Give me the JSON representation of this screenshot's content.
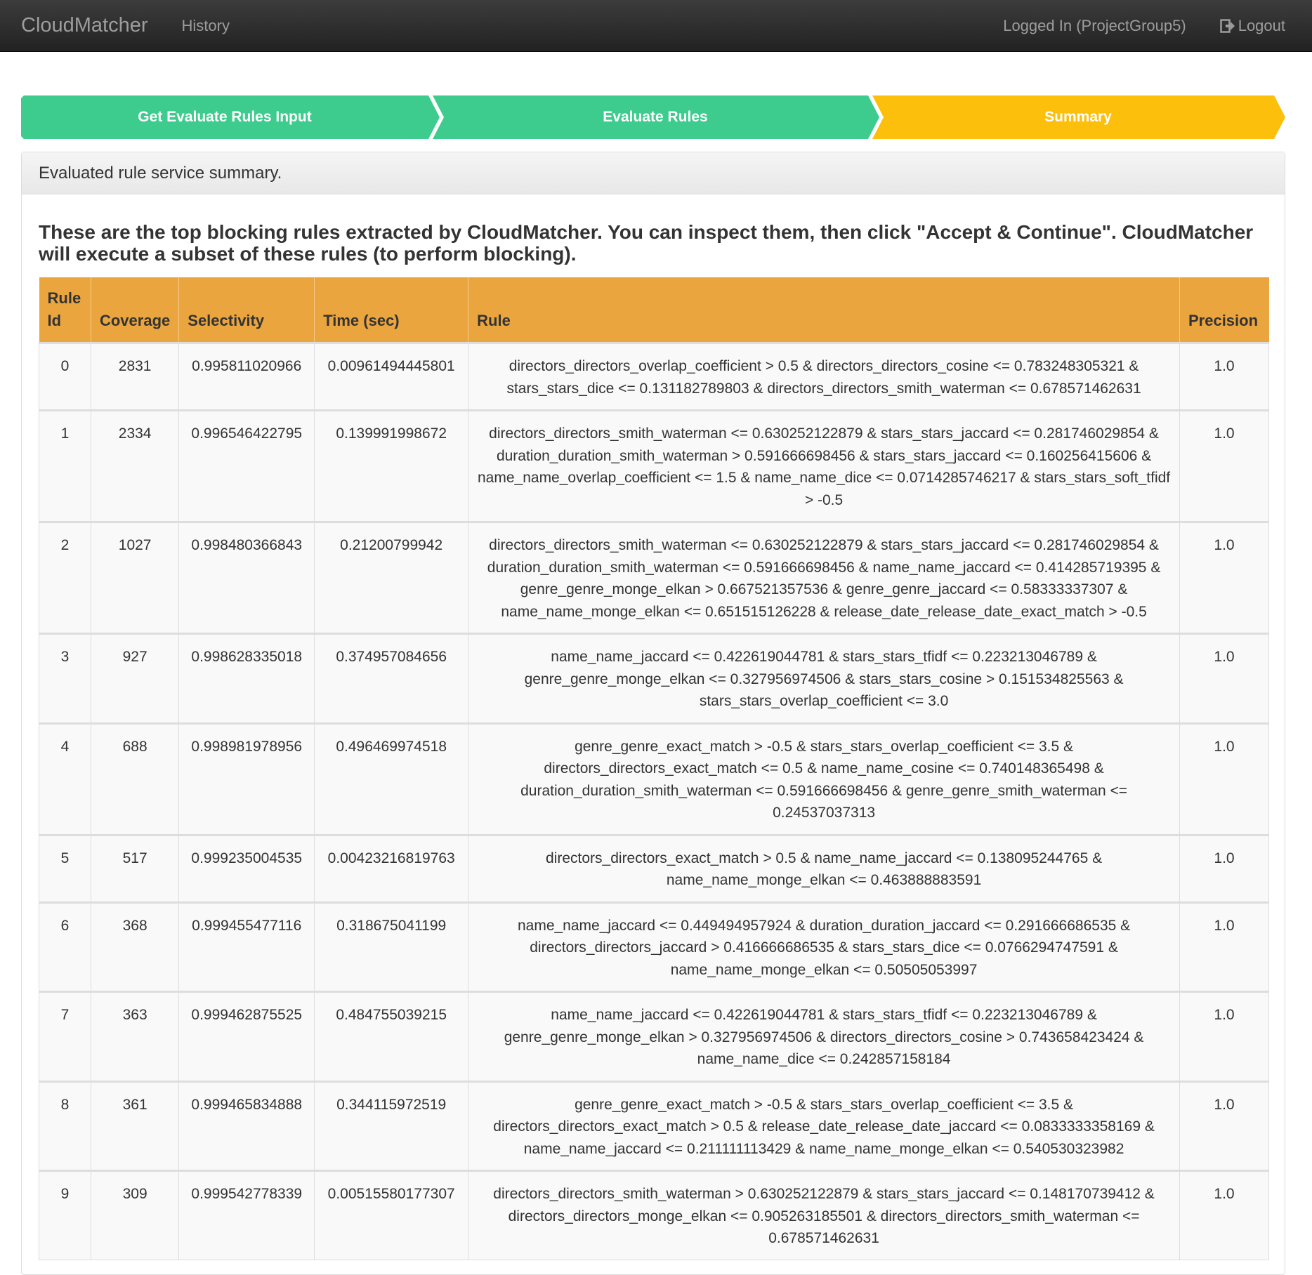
{
  "navbar": {
    "brand": "CloudMatcher",
    "history": "History",
    "user": "Logged In (ProjectGroup5)",
    "logout": "Logout",
    "logout_icon": "logout-icon"
  },
  "wizard": {
    "steps": [
      {
        "label": "Get Evaluate Rules Input",
        "color": "#3dcc8e"
      },
      {
        "label": "Evaluate Rules",
        "color": "#3dcc8e"
      },
      {
        "label": "Summary",
        "color": "#fbbf0c"
      }
    ]
  },
  "panel": {
    "heading": "Evaluated rule service summary.",
    "intro": "These are the top blocking rules extracted by CloudMatcher. You can inspect them, then click \"Accept & Continue\". CloudMatcher will execute a subset of these rules (to perform blocking)."
  },
  "table": {
    "headers": [
      "Rule Id",
      "Coverage",
      "Selectivity",
      "Time (sec)",
      "Rule",
      "Precision"
    ],
    "rows": [
      {
        "id": "0",
        "coverage": "2831",
        "selectivity": "0.995811020966",
        "time": "0.00961494445801",
        "rule": "directors_directors_overlap_coefficient > 0.5 & directors_directors_cosine <= 0.783248305321 & stars_stars_dice <= 0.131182789803 & directors_directors_smith_waterman <= 0.678571462631",
        "precision": "1.0"
      },
      {
        "id": "1",
        "coverage": "2334",
        "selectivity": "0.996546422795",
        "time": "0.139991998672",
        "rule": "directors_directors_smith_waterman <= 0.630252122879 & stars_stars_jaccard <= 0.281746029854 & duration_duration_smith_waterman > 0.591666698456 & stars_stars_jaccard <= 0.160256415606 & name_name_overlap_coefficient <= 1.5 & name_name_dice <= 0.0714285746217 & stars_stars_soft_tfidf > -0.5",
        "precision": "1.0"
      },
      {
        "id": "2",
        "coverage": "1027",
        "selectivity": "0.998480366843",
        "time": "0.21200799942",
        "rule": "directors_directors_smith_waterman <= 0.630252122879 & stars_stars_jaccard <= 0.281746029854 & duration_duration_smith_waterman <= 0.591666698456 & name_name_jaccard <= 0.414285719395 & genre_genre_monge_elkan > 0.667521357536 & genre_genre_jaccard <= 0.58333337307 & name_name_monge_elkan <= 0.651515126228 & release_date_release_date_exact_match > -0.5",
        "precision": "1.0"
      },
      {
        "id": "3",
        "coverage": "927",
        "selectivity": "0.998628335018",
        "time": "0.374957084656",
        "rule": "name_name_jaccard <= 0.422619044781 & stars_stars_tfidf <= 0.223213046789 & genre_genre_monge_elkan <= 0.327956974506 & stars_stars_cosine > 0.151534825563 & stars_stars_overlap_coefficient <= 3.0",
        "precision": "1.0"
      },
      {
        "id": "4",
        "coverage": "688",
        "selectivity": "0.998981978956",
        "time": "0.496469974518",
        "rule": "genre_genre_exact_match > -0.5 & stars_stars_overlap_coefficient <= 3.5 & directors_directors_exact_match <= 0.5 & name_name_cosine <= 0.740148365498 & duration_duration_smith_waterman <= 0.591666698456 & genre_genre_smith_waterman <= 0.24537037313",
        "precision": "1.0"
      },
      {
        "id": "5",
        "coverage": "517",
        "selectivity": "0.999235004535",
        "time": "0.00423216819763",
        "rule": "directors_directors_exact_match > 0.5 & name_name_jaccard <= 0.138095244765 & name_name_monge_elkan <= 0.463888883591",
        "precision": "1.0"
      },
      {
        "id": "6",
        "coverage": "368",
        "selectivity": "0.999455477116",
        "time": "0.318675041199",
        "rule": "name_name_jaccard <= 0.449494957924 & duration_duration_jaccard <= 0.291666686535 & directors_directors_jaccard > 0.416666686535 & stars_stars_dice <= 0.0766294747591 & name_name_monge_elkan <= 0.50505053997",
        "precision": "1.0"
      },
      {
        "id": "7",
        "coverage": "363",
        "selectivity": "0.999462875525",
        "time": "0.484755039215",
        "rule": "name_name_jaccard <= 0.422619044781 & stars_stars_tfidf <= 0.223213046789 & genre_genre_monge_elkan > 0.327956974506 & directors_directors_cosine > 0.743658423424 & name_name_dice <= 0.242857158184",
        "precision": "1.0"
      },
      {
        "id": "8",
        "coverage": "361",
        "selectivity": "0.999465834888",
        "time": "0.344115972519",
        "rule": "genre_genre_exact_match > -0.5 & stars_stars_overlap_coefficient <= 3.5 & directors_directors_exact_match > 0.5 & release_date_release_date_jaccard <= 0.0833333358169 & name_name_jaccard <= 0.211111113429 & name_name_monge_elkan <= 0.540530323982",
        "precision": "1.0"
      },
      {
        "id": "9",
        "coverage": "309",
        "selectivity": "0.999542778339",
        "time": "0.00515580177307",
        "rule": "directors_directors_smith_waterman > 0.630252122879 & stars_stars_jaccard <= 0.148170739412 & directors_directors_monge_elkan <= 0.905263185501 & directors_directors_smith_waterman <= 0.678571462631",
        "precision": "1.0"
      }
    ]
  }
}
